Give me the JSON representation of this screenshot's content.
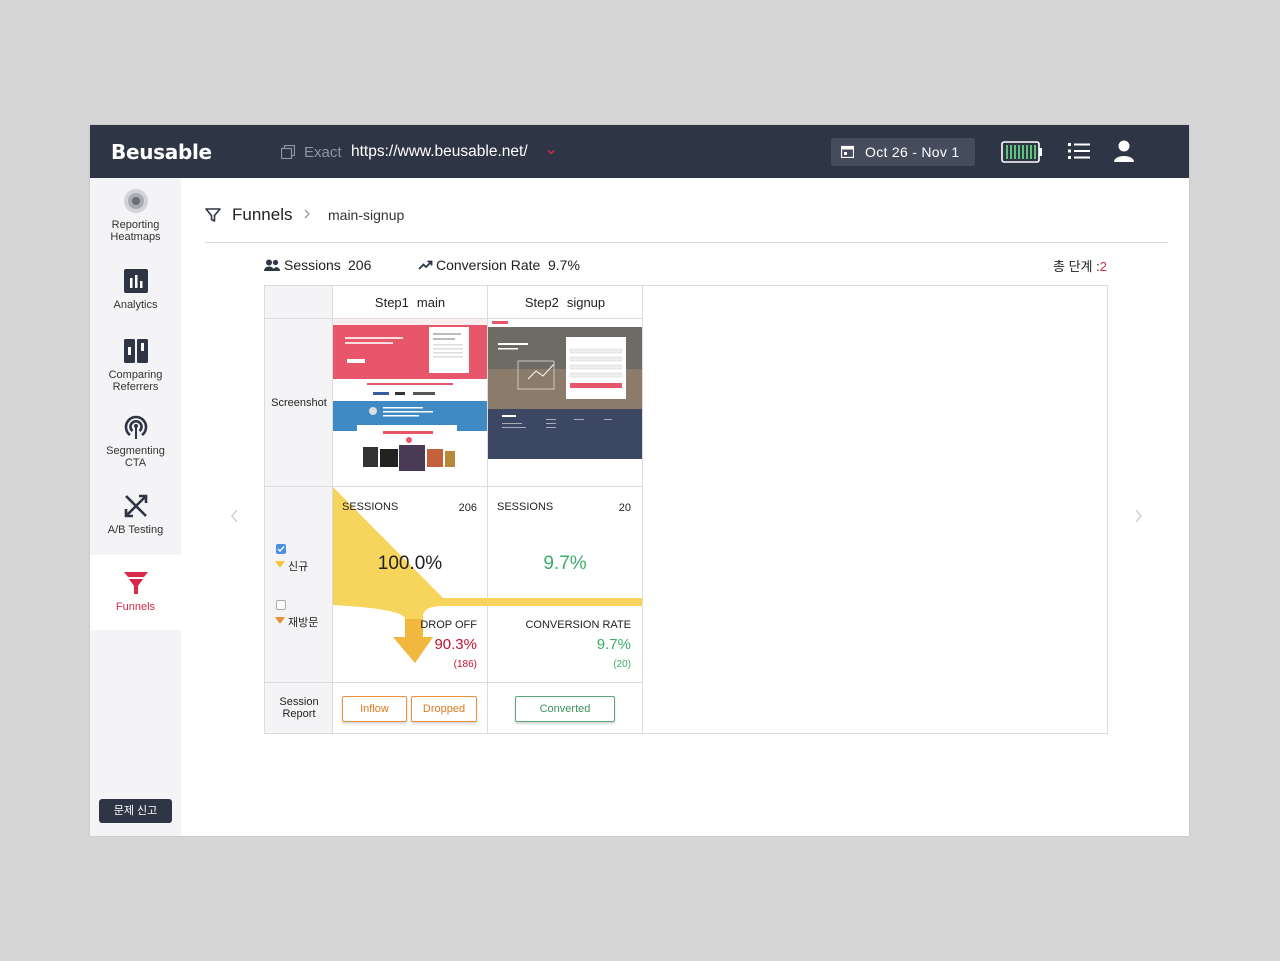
{
  "app": {
    "logo": "Beusable"
  },
  "topbar": {
    "url_mode": "Exact",
    "url": "https://www.beusable.net/",
    "date_range": "Oct 26 - Nov 1"
  },
  "sidebar": {
    "items": [
      {
        "label1": "Reporting",
        "label2": "Heatmaps"
      },
      {
        "label1": "Analytics",
        "label2": ""
      },
      {
        "label1": "Comparing",
        "label2": "Referrers"
      },
      {
        "label1": "Segmenting",
        "label2": "CTA"
      },
      {
        "label1": "A/B Testing",
        "label2": ""
      },
      {
        "label1": "Funnels",
        "label2": ""
      }
    ],
    "report_button": "문제 신고"
  },
  "breadcrumb": {
    "title": "Funnels",
    "sub": "main-signup"
  },
  "stats": {
    "sessions_label": "Sessions",
    "sessions_value": "206",
    "conversion_label": "Conversion Rate",
    "conversion_value": "9.7%",
    "total_steps_label": "총 단계 :",
    "total_steps_value": "2"
  },
  "table": {
    "row_labels": {
      "screenshot": "Screenshot",
      "session_report_1": "Session",
      "session_report_2": "Report"
    },
    "legend": {
      "new": "신규",
      "returning": "재방문"
    },
    "steps": [
      {
        "step": "Step1",
        "name": "main",
        "sessions_label": "SESSIONS",
        "sessions": "206",
        "percent": "100.0%",
        "bottom_label": "DROP OFF",
        "bottom_percent": "90.3%",
        "bottom_count": "(186)",
        "buttons": [
          "Inflow",
          "Dropped"
        ]
      },
      {
        "step": "Step2",
        "name": "signup",
        "sessions_label": "SESSIONS",
        "sessions": "20",
        "percent": "9.7%",
        "bottom_label": "CONVERSION RATE",
        "bottom_percent": "9.7%",
        "bottom_count": "(20)",
        "buttons": [
          "Converted"
        ]
      }
    ]
  },
  "colors": {
    "topbar": "#2e3545",
    "accent_red": "#d62a48",
    "funnel_yellow": "#f7d45c",
    "drop_red": "#c8102e",
    "conversion_green": "#3dab6a"
  }
}
